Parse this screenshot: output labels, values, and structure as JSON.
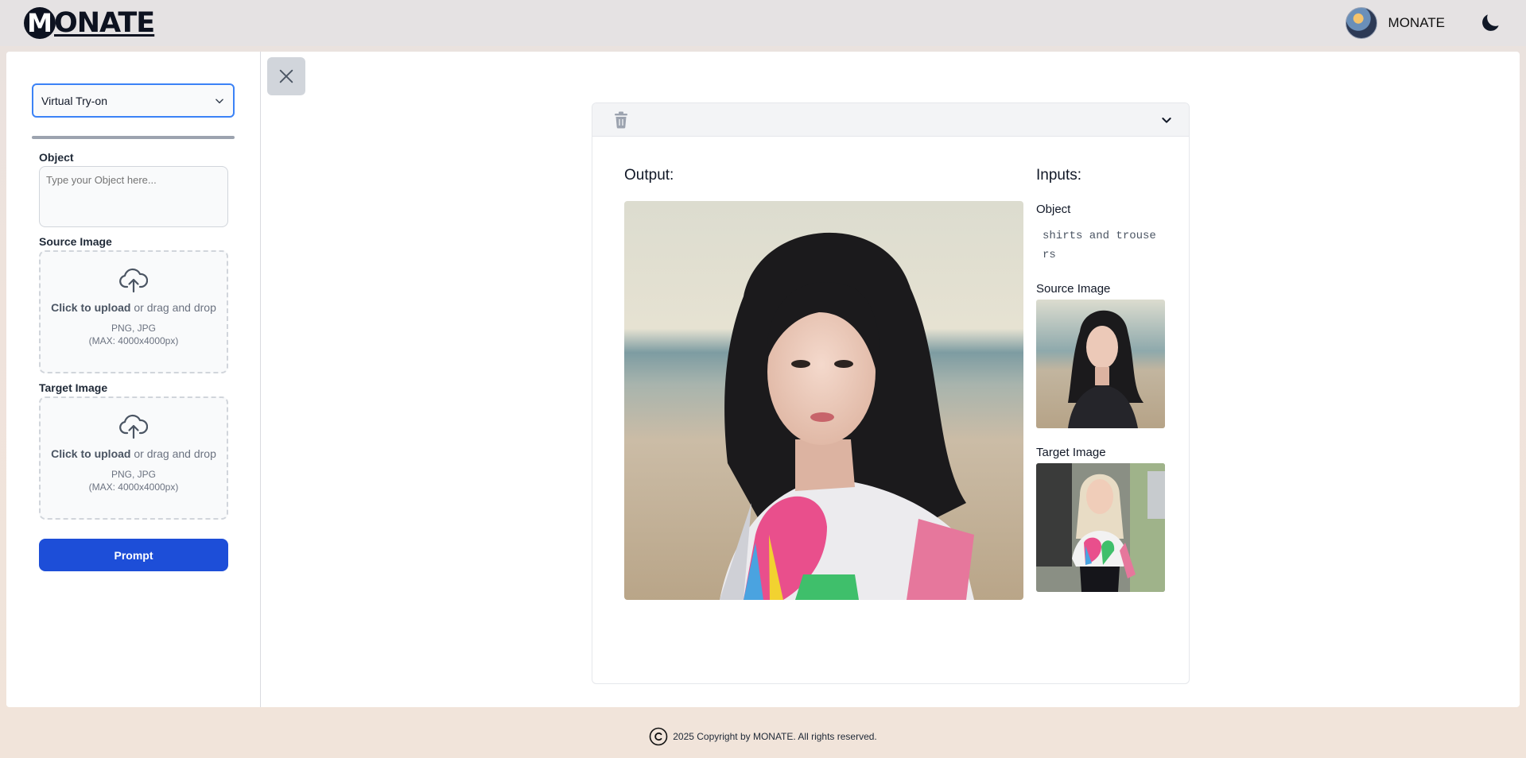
{
  "header": {
    "logo_letter": "M",
    "logo_text": "ONATE",
    "user_name": "MONATE",
    "avatar_icon": "avatar",
    "theme_icon": "moon-icon"
  },
  "sidebar": {
    "mode_select": {
      "selected": "Virtual Try-on",
      "icon": "chevron-down-icon"
    },
    "object_label": "Object",
    "object_placeholder": "Type your Object here...",
    "source_label": "Source Image",
    "target_label": "Target Image",
    "upload": {
      "click_text": "Click to upload",
      "drag_text": " or drag and drop",
      "formats": "PNG, JPG",
      "max_size": "(MAX: 4000x4000px)"
    },
    "prompt_button": "Prompt"
  },
  "result": {
    "output_title": "Output:",
    "inputs_title": "Inputs:",
    "object_label": "Object",
    "object_value": "shirts and trousers",
    "source_label": "Source Image",
    "target_label": "Target Image"
  },
  "footer": {
    "copyright": "2025 Copyright by MONATE. All rights reserved."
  },
  "colors": {
    "primary_button": "#1d4ed8",
    "select_border": "#3b82f6",
    "logo": "#0d1220"
  }
}
